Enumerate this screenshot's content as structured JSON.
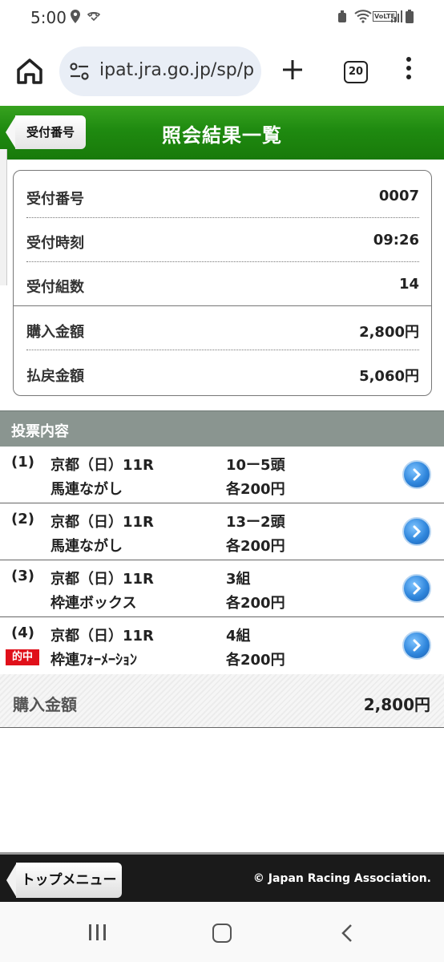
{
  "status_bar": {
    "time": "5:00",
    "icons_left": [
      "location-icon",
      "missed-call-icon"
    ],
    "icons_right": [
      "alarm-icon",
      "wifi-icon",
      "volte-icon",
      "signal-icon",
      "battery-icon"
    ],
    "volte_label": "VoLTE"
  },
  "browser": {
    "url": "ipat.jra.go.jp/sp/p",
    "tab_count": "20"
  },
  "header": {
    "back_label": "受付番号",
    "title": "照会結果一覧"
  },
  "summary": {
    "rows": [
      {
        "label": "受付番号",
        "value": "0007"
      },
      {
        "label": "受付時刻",
        "value": "09:26"
      },
      {
        "label": "受付組数",
        "value": "14"
      },
      {
        "label": "購入金額",
        "value": "2,800円"
      },
      {
        "label": "払戻金額",
        "value": "5,060円"
      }
    ]
  },
  "section": {
    "title": "投票内容"
  },
  "bets": [
    {
      "num": "(1)",
      "race": "京都（日）11R",
      "type": "馬連ながし",
      "combo": "10ー5頭",
      "amount": "各200円",
      "hit": ""
    },
    {
      "num": "(2)",
      "race": "京都（日）11R",
      "type": "馬連ながし",
      "combo": "13ー2頭",
      "amount": "各200円",
      "hit": ""
    },
    {
      "num": "(3)",
      "race": "京都（日）11R",
      "type": "枠連ボックス",
      "combo": "3組",
      "amount": "各200円",
      "hit": ""
    },
    {
      "num": "(4)",
      "race": "京都（日）11R",
      "type": "枠連ﾌｫｰﾒｰｼｮﾝ",
      "combo": "4組",
      "amount": "各200円",
      "hit": "的中"
    }
  ],
  "total": {
    "label": "購入金額",
    "value": "2,800円"
  },
  "footer": {
    "top_menu_label": "トップメニュー",
    "copyright": "© Japan Racing Association."
  },
  "colors": {
    "header_green": "#1f8a10",
    "section_gray": "#8a9590",
    "hit_red": "#e0101a",
    "detail_blue": "#2f86dc"
  }
}
